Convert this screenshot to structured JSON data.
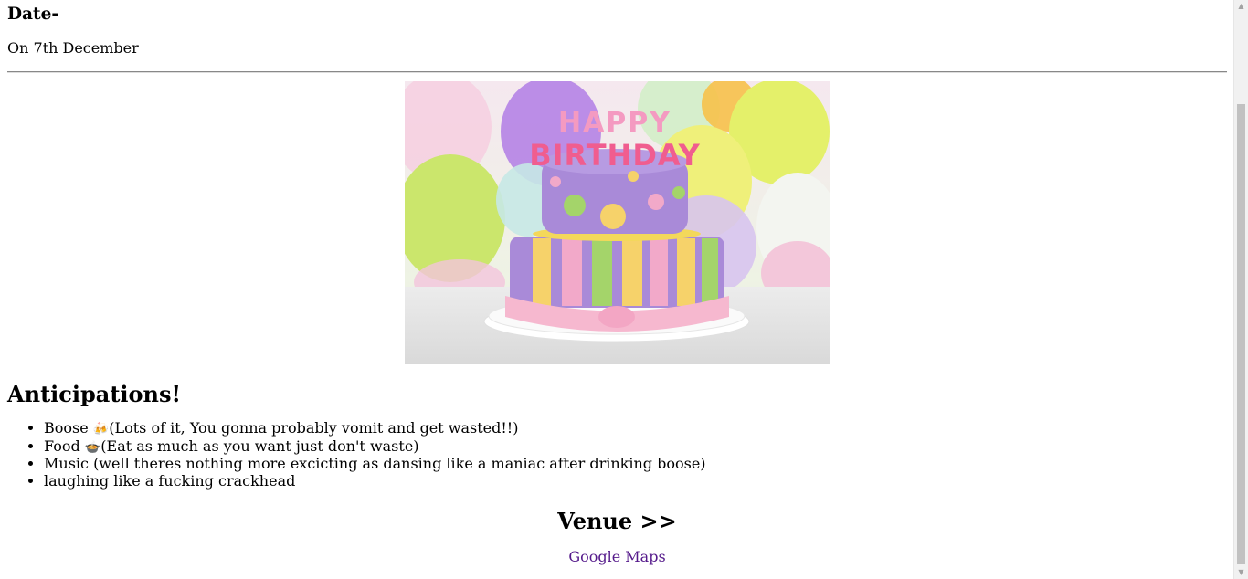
{
  "date": {
    "heading": "Date-",
    "text": "On 7th December"
  },
  "image": {
    "alt": "Happy Birthday cake",
    "cake_letters": "HAPPY BIRTHDAY"
  },
  "anticipations": {
    "heading": "Anticipations!",
    "items": [
      {
        "label": "Boose ",
        "emoji": "🍻",
        "note": "(Lots of it, You gonna probably vomit and get wasted!!)"
      },
      {
        "label": "Food ",
        "emoji": "🍲",
        "note": "(Eat as much as you want just don't waste)"
      },
      {
        "label": "Music (well theres nothing more excicting as dansing like a maniac after drinking boose)",
        "emoji": "",
        "note": ""
      },
      {
        "label": "laughing like a fucking crackhead",
        "emoji": "",
        "note": ""
      }
    ]
  },
  "venue": {
    "heading": "Venue >>",
    "link_label": "Google Maps"
  },
  "scrollbar": {
    "up_arrow": "▲",
    "down_arrow": "▼"
  }
}
